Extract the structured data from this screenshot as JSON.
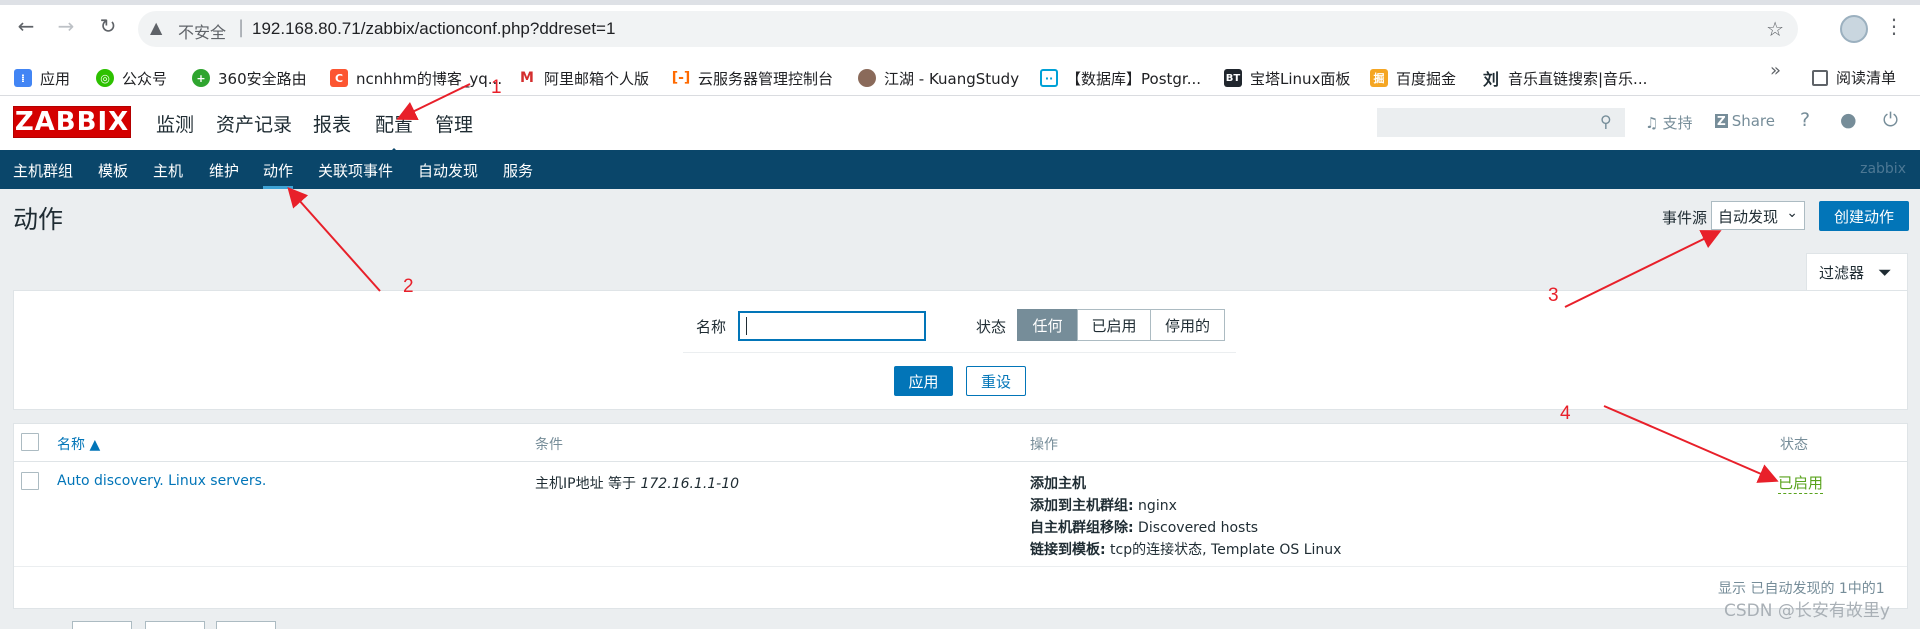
{
  "browser": {
    "insecure_label": "不安全",
    "url": "192.168.80.71/zabbix/actionconf.php?ddreset=1",
    "bookmarks": [
      {
        "label": "应用",
        "icon": "apps-grid-icon"
      },
      {
        "label": "公众号",
        "icon": "wechat-icon"
      },
      {
        "label": "360安全路由",
        "icon": "360-icon"
      },
      {
        "label": "ncnhhm的博客_yq...",
        "icon": "csdn-icon"
      },
      {
        "label": "阿里邮箱个人版",
        "icon": "mail-icon"
      },
      {
        "label": "云服务器管理控制台",
        "icon": "aliyun-icon"
      },
      {
        "label": "江湖 - KuangStudy",
        "icon": "avatar-icon"
      },
      {
        "label": "【数据库】Postgr...",
        "icon": "bilibili-icon"
      },
      {
        "label": "宝塔Linux面板",
        "icon": "bt-icon"
      },
      {
        "label": "百度掘金",
        "icon": "juejin-icon"
      },
      {
        "label": "音乐直链搜索|音乐...",
        "icon": "music-icon"
      }
    ],
    "more_label": "»",
    "reading_list": "阅读清单"
  },
  "header": {
    "logo": "ZABBIX",
    "menu": [
      "监测",
      "资产记录",
      "报表",
      "配置",
      "管理"
    ],
    "support": "支持",
    "share": "Share"
  },
  "subnav": {
    "items": [
      "主机群组",
      "模板",
      "主机",
      "维护",
      "动作",
      "关联项事件",
      "自动发现",
      "服务"
    ],
    "brand": "zabbix"
  },
  "page": {
    "title": "动作",
    "event_source_label": "事件源",
    "event_source_value": "自动发现",
    "create_button": "创建动作"
  },
  "filter": {
    "tab_label": "过滤器",
    "name_label": "名称",
    "name_value": "",
    "status_label": "状态",
    "status_options": [
      "任何",
      "已启用",
      "停用的"
    ],
    "status_selected": "任何",
    "apply": "应用",
    "reset": "重设"
  },
  "table": {
    "headers": {
      "name": "名称 ▲",
      "conditions": "条件",
      "operations": "操作",
      "status": "状态"
    },
    "rows": [
      {
        "name": "Auto discovery. Linux servers.",
        "condition_prefix": "主机IP地址 等于 ",
        "condition_value": "172.16.1.1-10",
        "operations": [
          {
            "label": "添加主机",
            "value": ""
          },
          {
            "label": "添加到主机群组:",
            "value": " nginx"
          },
          {
            "label": "自主机群组移除:",
            "value": " Discovered hosts"
          },
          {
            "label": "链接到模板:",
            "value": " tcp的连接状态, Template OS Linux"
          }
        ],
        "status": "已启用"
      }
    ],
    "footer": "显示 已自动发现的 1中的1"
  },
  "annotations": [
    "1",
    "2",
    "3",
    "4"
  ],
  "watermark": "CSDN @长安有故里y",
  "colors": {
    "zabbix_red": "#d40000",
    "subnav_bg": "#0a466a",
    "primary_blue": "#0275b8",
    "enabled_green": "#59a31d",
    "annotation_red": "#e8202a"
  }
}
